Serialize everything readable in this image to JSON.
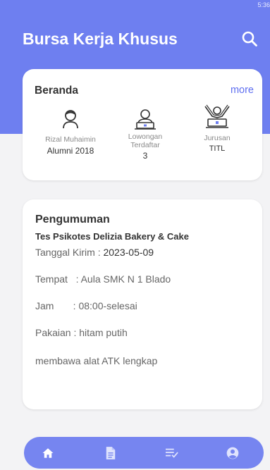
{
  "status_bar": {
    "time": "5:36"
  },
  "header": {
    "title": "Bursa Kerja Khusus",
    "search_icon": "search-icon"
  },
  "colors": {
    "primary": "#6e7ff0",
    "navbar": "#7685f0",
    "link": "#5f6ff0"
  },
  "beranda": {
    "title": "Beranda",
    "more_label": "more",
    "user": {
      "icon": "user-icon",
      "name": "Rizal Muhaimin",
      "status": "Alumni 2018"
    },
    "jobs": {
      "icon": "computer-user-icon",
      "label_line1": "Lowongan",
      "label_line2": "Terdaftar",
      "count": "3"
    },
    "department": {
      "icon": "celebrate-person-icon",
      "label": "Jurusan",
      "value": "TITL"
    }
  },
  "pengumuman": {
    "title": "Pengumuman",
    "subject": "Tes Psikotes Delizia Bakery & Cake",
    "date_label": "Tanggal Kirim : ",
    "date_value": "2023-05-09",
    "place": "Tempat   : Aula SMK N 1 Blado",
    "time": "Jam       : 08:00-selesai",
    "dress": "Pakaian : hitam putih",
    "note": "membawa alat ATK lengkap"
  },
  "bottom_nav": {
    "items": [
      {
        "icon": "home-icon",
        "active": true
      },
      {
        "icon": "document-icon",
        "active": false
      },
      {
        "icon": "list-check-icon",
        "active": false
      },
      {
        "icon": "account-circle-icon",
        "active": false
      }
    ]
  }
}
